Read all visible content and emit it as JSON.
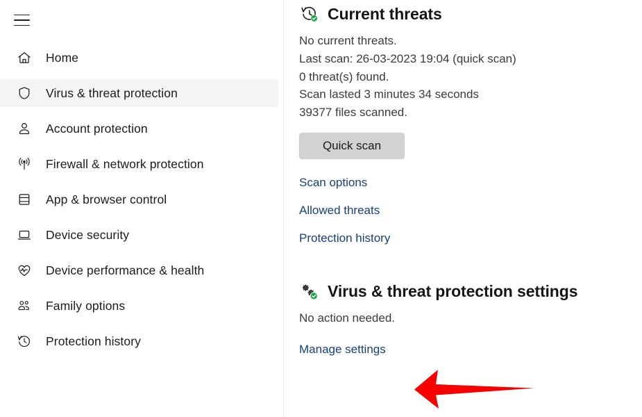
{
  "sidebar": {
    "menu_button": "hamburger-menu",
    "items": [
      {
        "label": "Home",
        "icon": "home-icon",
        "selected": false
      },
      {
        "label": "Virus & threat protection",
        "icon": "shield-icon",
        "selected": true
      },
      {
        "label": "Account protection",
        "icon": "person-icon",
        "selected": false
      },
      {
        "label": "Firewall & network protection",
        "icon": "broadcast-icon",
        "selected": false
      },
      {
        "label": "App & browser control",
        "icon": "window-icon",
        "selected": false
      },
      {
        "label": "Device security",
        "icon": "laptop-icon",
        "selected": false
      },
      {
        "label": "Device performance & health",
        "icon": "heart-pulse-icon",
        "selected": false
      },
      {
        "label": "Family options",
        "icon": "people-icon",
        "selected": false
      },
      {
        "label": "Protection history",
        "icon": "clock-history-icon",
        "selected": false
      }
    ],
    "selection_accent": "#005fb8",
    "selected_row_bg": "#f4f4f4"
  },
  "main": {
    "current_threats": {
      "icon": "clock-history-check-icon",
      "title": "Current threats",
      "lines": [
        "No current threats.",
        "Last scan: 26-03-2023 19:04 (quick scan)",
        "0 threat(s) found.",
        "Scan lasted 3 minutes 34 seconds",
        "39377 files scanned."
      ],
      "quick_scan_button": "Quick scan",
      "links": [
        "Scan options",
        "Allowed threats",
        "Protection history"
      ]
    },
    "protection_settings": {
      "icon": "gears-check-icon",
      "title": "Virus & threat protection settings",
      "status": "No action needed.",
      "link": "Manage settings"
    },
    "link_color": "#15417e",
    "button_color": "#d2d2d2",
    "status_check_color": "#12a33c"
  },
  "annotation": {
    "arrow": "red-left-arrow",
    "color": "#f80000",
    "points_to": "Manage settings"
  }
}
